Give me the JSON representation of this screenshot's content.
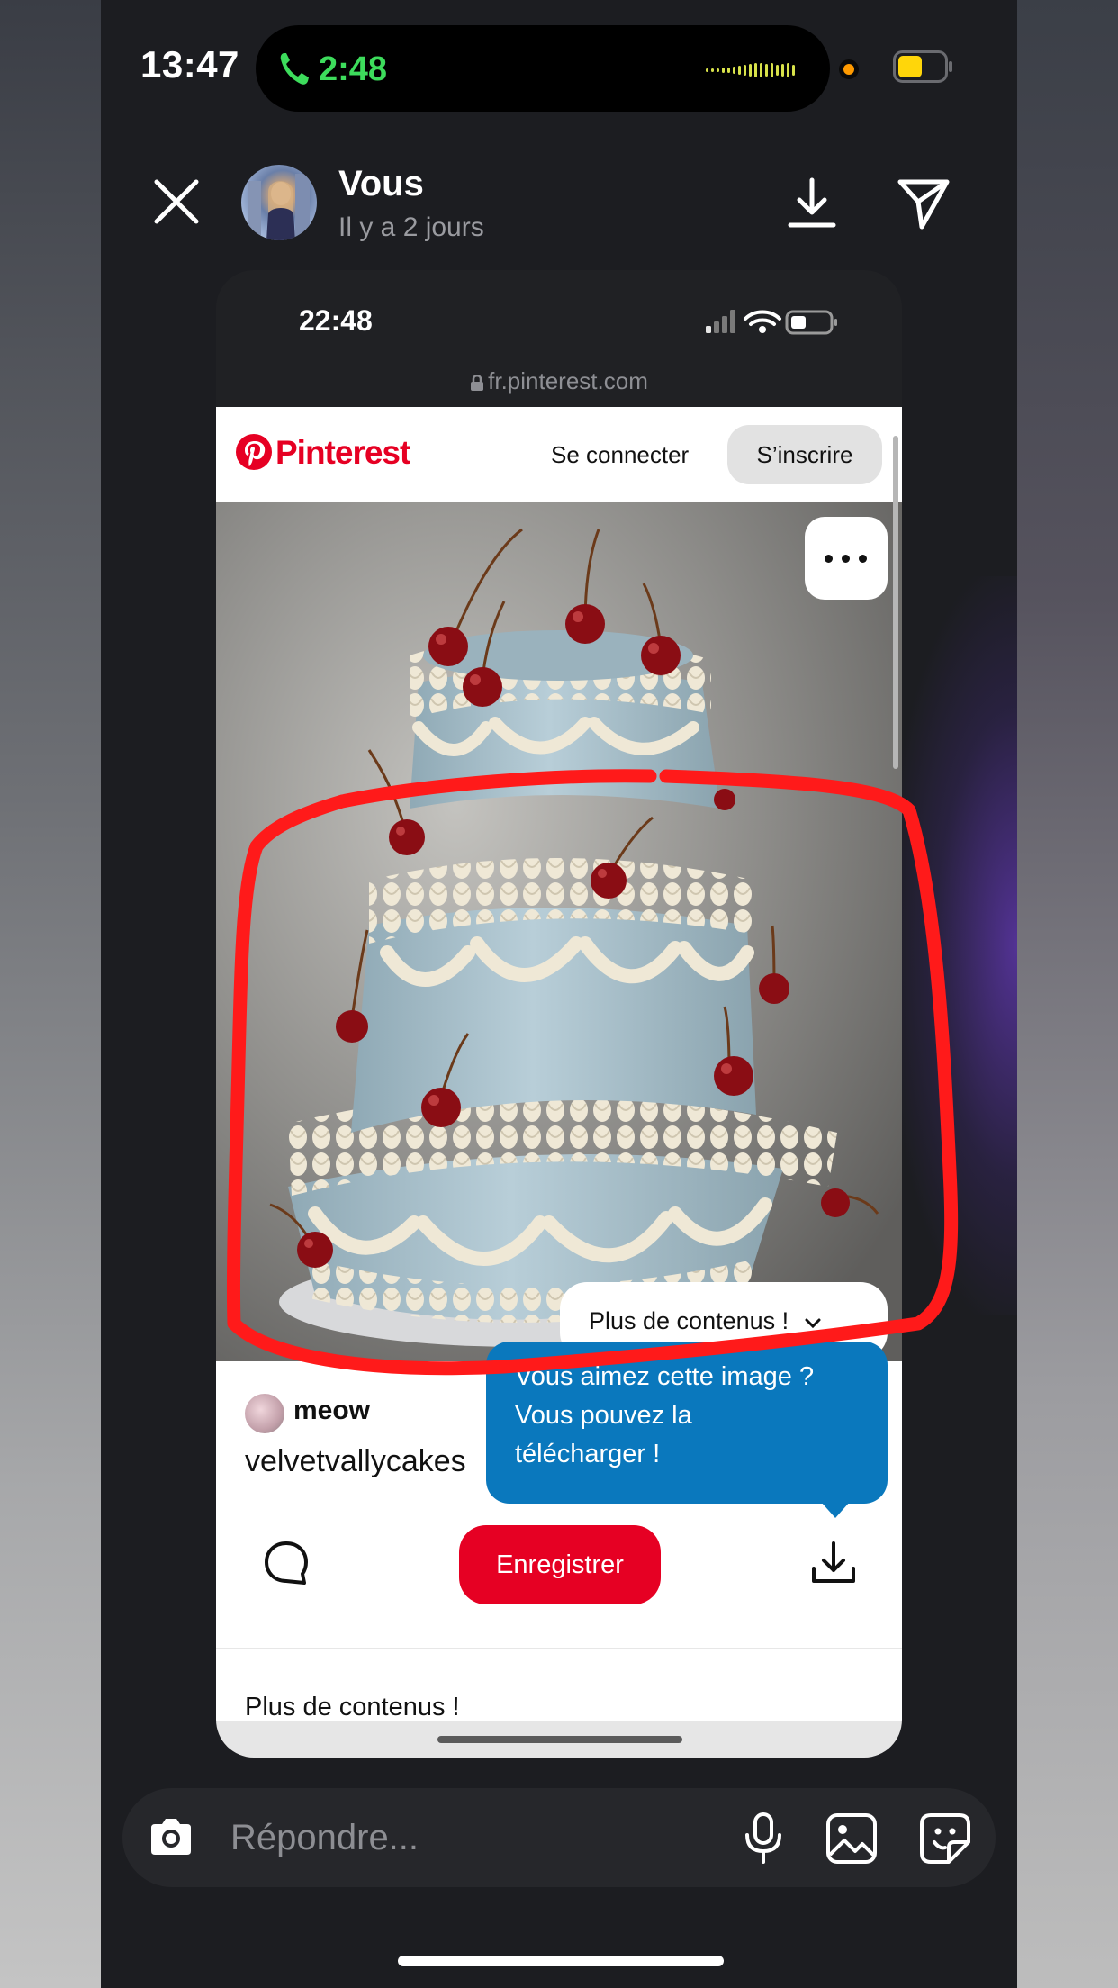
{
  "status_bar": {
    "time": "13:47",
    "call_duration": "2:48"
  },
  "story": {
    "author": "Vous",
    "posted": "Il y a 2 jours"
  },
  "screenshot": {
    "time": "22:48",
    "url": "fr.pinterest.com",
    "brand": "Pinterest",
    "login_label": "Se connecter",
    "signup_label": "S’inscrire",
    "more_content_pill": "Plus de contenus !",
    "tooltip_lines": [
      "Vous aimez cette image ?",
      "Vous pouvez la",
      "télécharger !"
    ],
    "username": "meow",
    "description": "velvetvallycakes",
    "save_label": "Enregistrer",
    "more_heading": "Plus de contenus !"
  },
  "reply": {
    "placeholder": "Répondre..."
  },
  "colors": {
    "pinterest_red": "#e60023",
    "tooltip_blue": "#0a78bd",
    "call_green": "#3ddc5c",
    "annotation_red": "#ff1a1a"
  },
  "icons": {
    "close": "close-icon",
    "download": "download-icon",
    "send": "send-icon",
    "camera": "camera-icon",
    "mic": "microphone-icon",
    "gallery": "gallery-icon",
    "sticker": "sticker-icon",
    "comment": "comment-icon",
    "more": "more-options-icon"
  }
}
